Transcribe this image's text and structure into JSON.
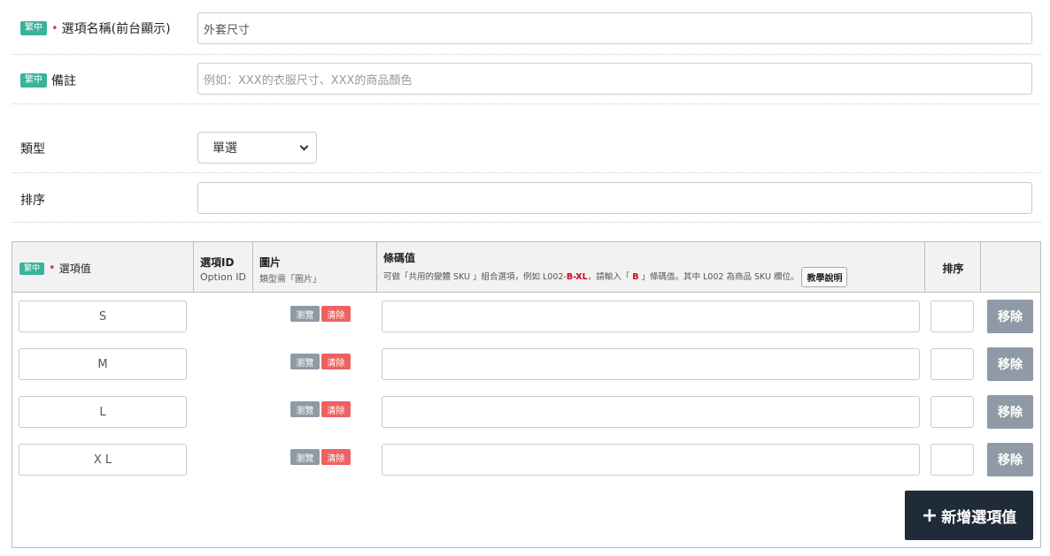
{
  "lang_badge": "繁中",
  "required_mark": "•",
  "fields": {
    "option_name": {
      "label": "選項名稱(前台顯示)",
      "value": "外套尺寸"
    },
    "note": {
      "label": "備註",
      "placeholder": "例如：XXX的衣服尺寸、XXX的商品顏色"
    },
    "type": {
      "label": "類型",
      "selected": "單選"
    },
    "sort": {
      "label": "排序",
      "value": ""
    }
  },
  "table": {
    "headers": {
      "value": "選項值",
      "option_id_title": "選項ID",
      "option_id_sub": "Option ID",
      "image_title": "圖片",
      "image_sub": "類型需「圖片」",
      "barcode_title": "條碼值",
      "barcode_desc_1": "可做「共用的變體 SKU 」組合選項，例如 L002-",
      "barcode_desc_hl_1": "B",
      "barcode_desc_2": "-",
      "barcode_desc_hl_2": "XL",
      "barcode_desc_3": "，請輸入「 ",
      "barcode_desc_hl_3": "B",
      "barcode_desc_4": " 」條碼值。其中 L002 為商品 SKU 欄位。",
      "help_button": "教學說明",
      "sort": "排序"
    },
    "rows": [
      {
        "value": "S"
      },
      {
        "value": "M"
      },
      {
        "value": "L"
      },
      {
        "value": "X L"
      }
    ],
    "browse_label": "瀏覽",
    "clear_label": "清除",
    "remove_label": "移除",
    "add_button": "新增選項值",
    "add_icon": "+"
  },
  "colors": {
    "badge": "#3bb39a",
    "required": "#e53b3b",
    "browse": "#8f9aa6",
    "clear": "#f06161",
    "remove": "#8f9aa6",
    "add": "#1f2b38"
  }
}
